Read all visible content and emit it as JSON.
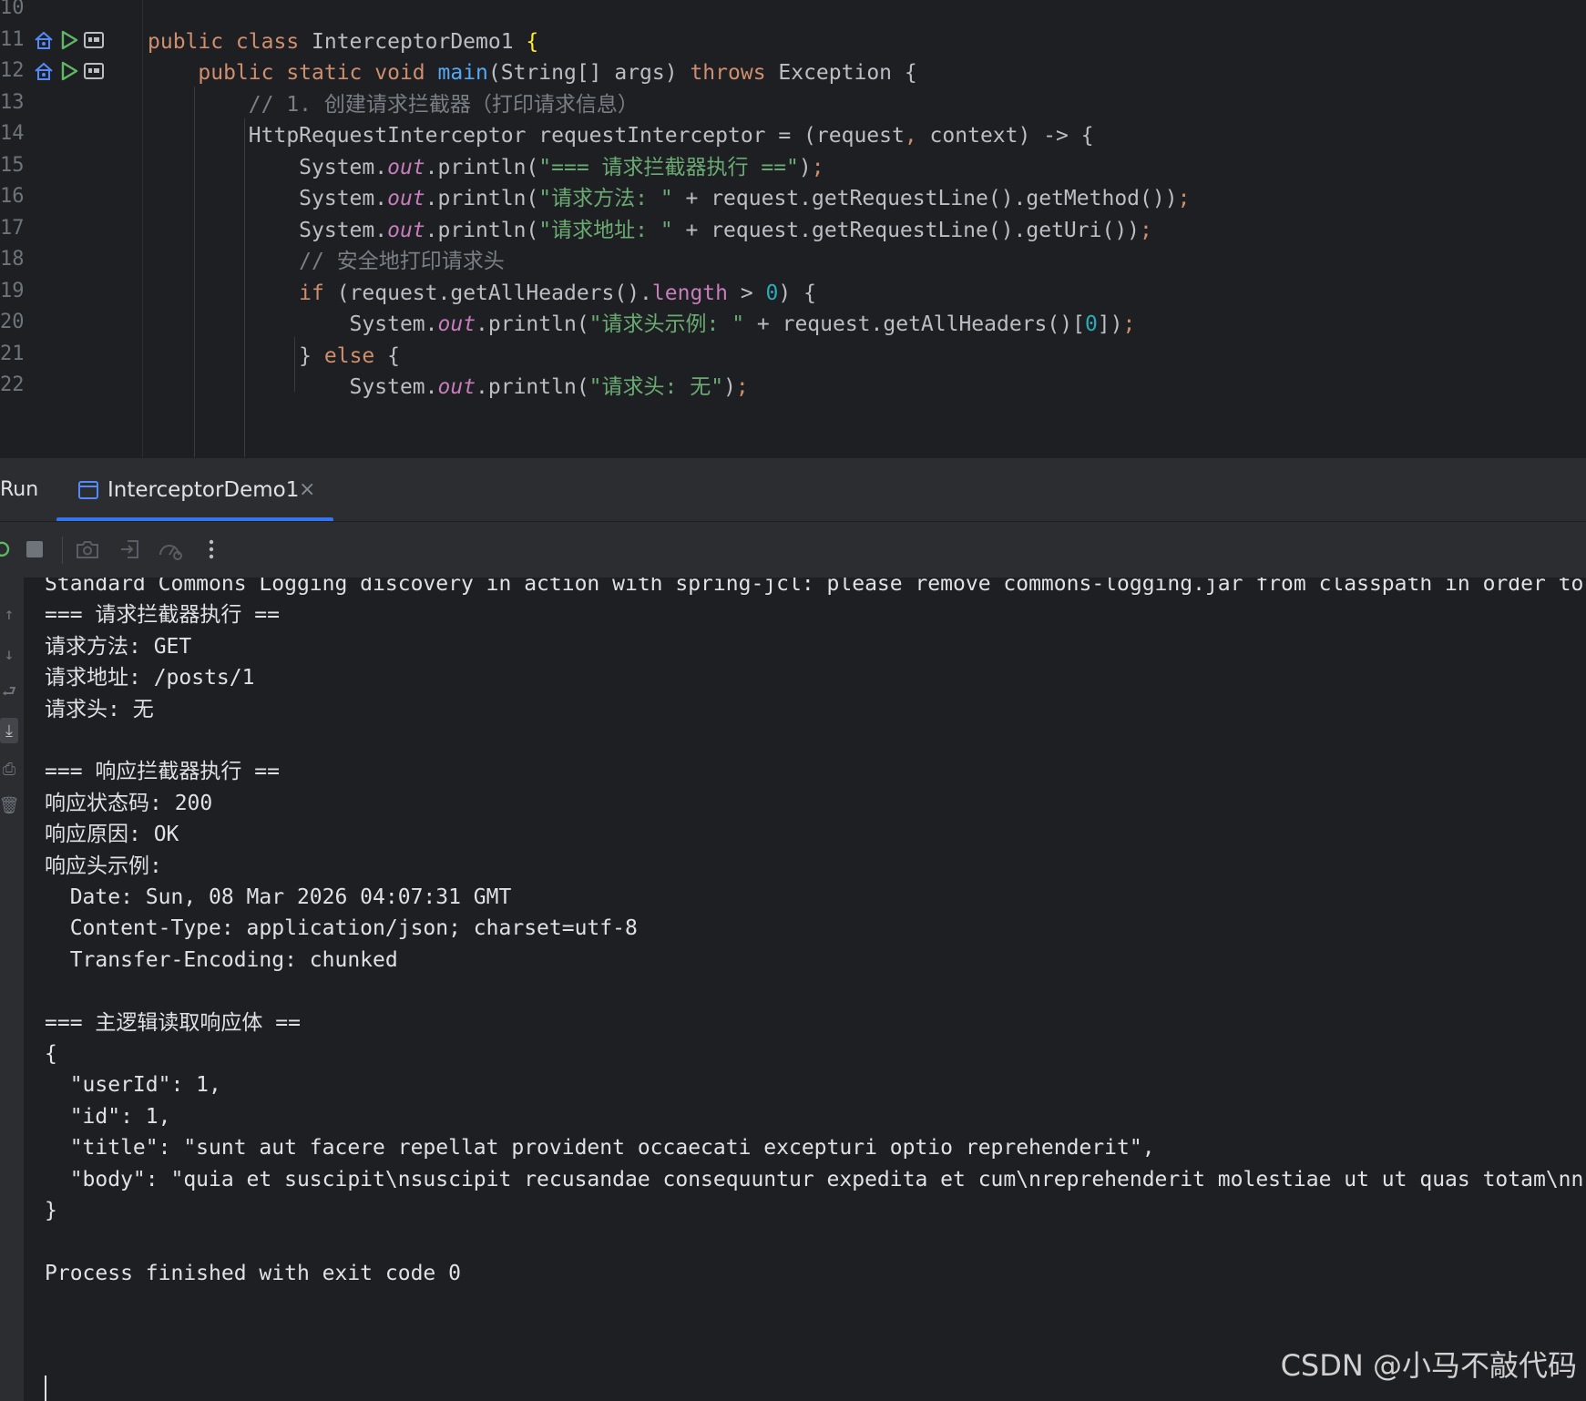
{
  "editor": {
    "line_numbers": [
      "10",
      "11",
      "12",
      "13",
      "14",
      "15",
      "16",
      "17",
      "18",
      "19",
      "20",
      "21",
      "22"
    ],
    "lines": [
      {
        "segments": []
      },
      {
        "segments": [
          {
            "t": "public class ",
            "c": "kw"
          },
          {
            "t": "InterceptorDemo1 ",
            "c": "plain"
          },
          {
            "t": "{",
            "c": "brace"
          }
        ]
      },
      {
        "segments": [
          {
            "t": "    public static void ",
            "c": "kw"
          },
          {
            "t": "main",
            "c": "fn"
          },
          {
            "t": "(String[] args) ",
            "c": "plain"
          },
          {
            "t": "throws ",
            "c": "kw"
          },
          {
            "t": "Exception {",
            "c": "plain"
          }
        ]
      },
      {
        "segments": [
          {
            "t": "        // 1. 创建请求拦截器（打印请求信息）",
            "c": "comment"
          }
        ]
      },
      {
        "segments": [
          {
            "t": "        HttpRequestInterceptor requestInterceptor = (request",
            "c": "plain"
          },
          {
            "t": ",",
            "c": "kw"
          },
          {
            "t": " context) -> {",
            "c": "plain"
          }
        ]
      },
      {
        "segments": [
          {
            "t": "            System.",
            "c": "plain"
          },
          {
            "t": "out",
            "c": "static"
          },
          {
            "t": ".println(",
            "c": "plain"
          },
          {
            "t": "\"=== 请求拦截器执行 ==\"",
            "c": "str"
          },
          {
            "t": ")",
            "c": "plain"
          },
          {
            "t": ";",
            "c": "kw"
          }
        ]
      },
      {
        "segments": [
          {
            "t": "            System.",
            "c": "plain"
          },
          {
            "t": "out",
            "c": "static"
          },
          {
            "t": ".println(",
            "c": "plain"
          },
          {
            "t": "\"请求方法: \"",
            "c": "str"
          },
          {
            "t": " + request.getRequestLine().getMethod())",
            "c": "plain"
          },
          {
            "t": ";",
            "c": "kw"
          }
        ]
      },
      {
        "segments": [
          {
            "t": "            System.",
            "c": "plain"
          },
          {
            "t": "out",
            "c": "static"
          },
          {
            "t": ".println(",
            "c": "plain"
          },
          {
            "t": "\"请求地址: \"",
            "c": "str"
          },
          {
            "t": " + request.getRequestLine().getUri())",
            "c": "plain"
          },
          {
            "t": ";",
            "c": "kw"
          }
        ]
      },
      {
        "segments": [
          {
            "t": "            // 安全地打印请求头",
            "c": "comment"
          }
        ]
      },
      {
        "segments": [
          {
            "t": "            if ",
            "c": "kw"
          },
          {
            "t": "(request.getAllHeaders().",
            "c": "plain"
          },
          {
            "t": "length",
            "c": "field"
          },
          {
            "t": " > ",
            "c": "plain"
          },
          {
            "t": "0",
            "c": "num"
          },
          {
            "t": ") {",
            "c": "plain"
          }
        ]
      },
      {
        "segments": [
          {
            "t": "                System.",
            "c": "plain"
          },
          {
            "t": "out",
            "c": "static"
          },
          {
            "t": ".println(",
            "c": "plain"
          },
          {
            "t": "\"请求头示例: \"",
            "c": "str"
          },
          {
            "t": " + request.getAllHeaders()[",
            "c": "plain"
          },
          {
            "t": "0",
            "c": "num"
          },
          {
            "t": "])",
            "c": "plain"
          },
          {
            "t": ";",
            "c": "kw"
          }
        ]
      },
      {
        "segments": [
          {
            "t": "            } ",
            "c": "plain"
          },
          {
            "t": "else ",
            "c": "kw"
          },
          {
            "t": "{",
            "c": "plain"
          }
        ]
      },
      {
        "segments": [
          {
            "t": "                System.",
            "c": "plain"
          },
          {
            "t": "out",
            "c": "static"
          },
          {
            "t": ".println(",
            "c": "plain"
          },
          {
            "t": "\"请求头: 无\"",
            "c": "str"
          },
          {
            "t": ")",
            "c": "plain"
          },
          {
            "t": ";",
            "c": "kw"
          }
        ]
      }
    ]
  },
  "run_panel": {
    "label": "Run",
    "tab_label": "InterceptorDemo1",
    "tab_close": "×"
  },
  "console": {
    "lines": [
      "Standard Commons Logging discovery in action with spring-jcl: please remove commons-logging.jar from classpath in order to",
      "=== 请求拦截器执行 ==",
      "请求方法: GET",
      "请求地址: /posts/1",
      "请求头: 无",
      "",
      "=== 响应拦截器执行 ==",
      "响应状态码: 200",
      "响应原因: OK",
      "响应头示例:",
      "  Date: Sun, 08 Mar 2026 04:07:31 GMT",
      "  Content-Type: application/json; charset=utf-8",
      "  Transfer-Encoding: chunked",
      "",
      "=== 主逻辑读取响应体 ==",
      "{",
      "  \"userId\": 1,",
      "  \"id\": 1,",
      "  \"title\": \"sunt aut facere repellat provident occaecati excepturi optio reprehenderit\",",
      "  \"body\": \"quia et suscipit\\nsuscipit recusandae consequuntur expedita et cum\\nreprehenderit molestiae ut ut quas totam\\nn",
      "}",
      "",
      "Process finished with exit code 0"
    ]
  },
  "watermark": "CSDN @小马不敲代码",
  "colors": {
    "background": "#1e1f22",
    "panel": "#2b2d30",
    "keyword": "#cf8e6d",
    "function": "#56a8f5",
    "string": "#6aab73",
    "number": "#2aacb8",
    "static_field": "#c77dbb",
    "comment": "#7a7e85",
    "accent": "#3574f0",
    "run_green": "#5fb865"
  }
}
